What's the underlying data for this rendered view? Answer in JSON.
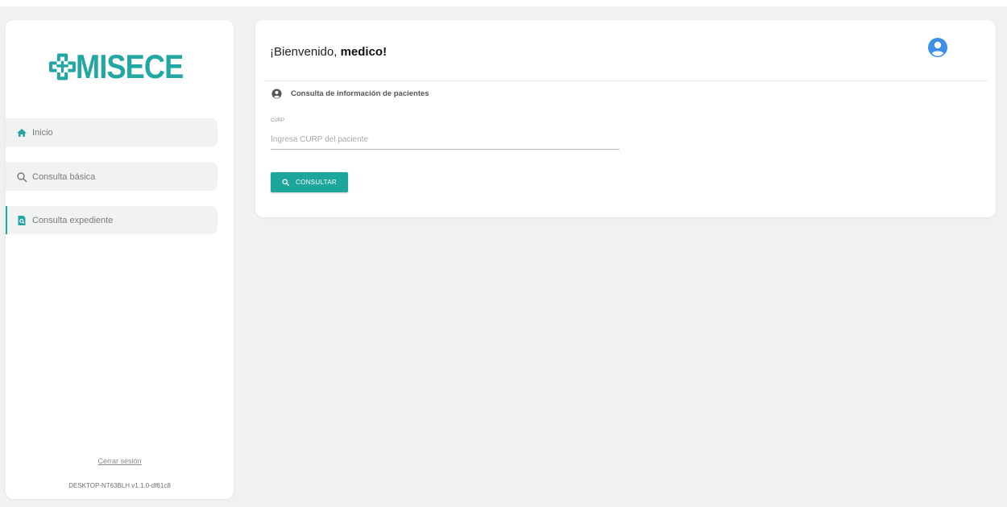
{
  "brand": {
    "name": "MISECE",
    "color": "#23a7a3"
  },
  "sidebar": {
    "items": [
      {
        "label": "Inicio",
        "icon": "home-icon"
      },
      {
        "label": "Consulta básica",
        "icon": "search-icon"
      },
      {
        "label": "Consulta expediente",
        "icon": "file-search-icon",
        "active": true
      }
    ],
    "logout": "Cerrar sesión",
    "version": "DESKTOP-NT63BLH v1.1.0-df61c8"
  },
  "header": {
    "greeting": "¡Bienvenido,",
    "username": "medico!",
    "avatar_icon": "user-circle-icon"
  },
  "section": {
    "title": "Consulta de información de pacientes",
    "icon": "user-circle-icon"
  },
  "form": {
    "curp_label": "CURP",
    "curp_placeholder": "Ingresa CURP del paciente",
    "curp_value": "",
    "submit_label": "CONSULTAR",
    "submit_icon": "search-icon"
  },
  "colors": {
    "accent": "#1da69c",
    "avatar": "#3f8fe6",
    "background": "#f1f1f1"
  }
}
